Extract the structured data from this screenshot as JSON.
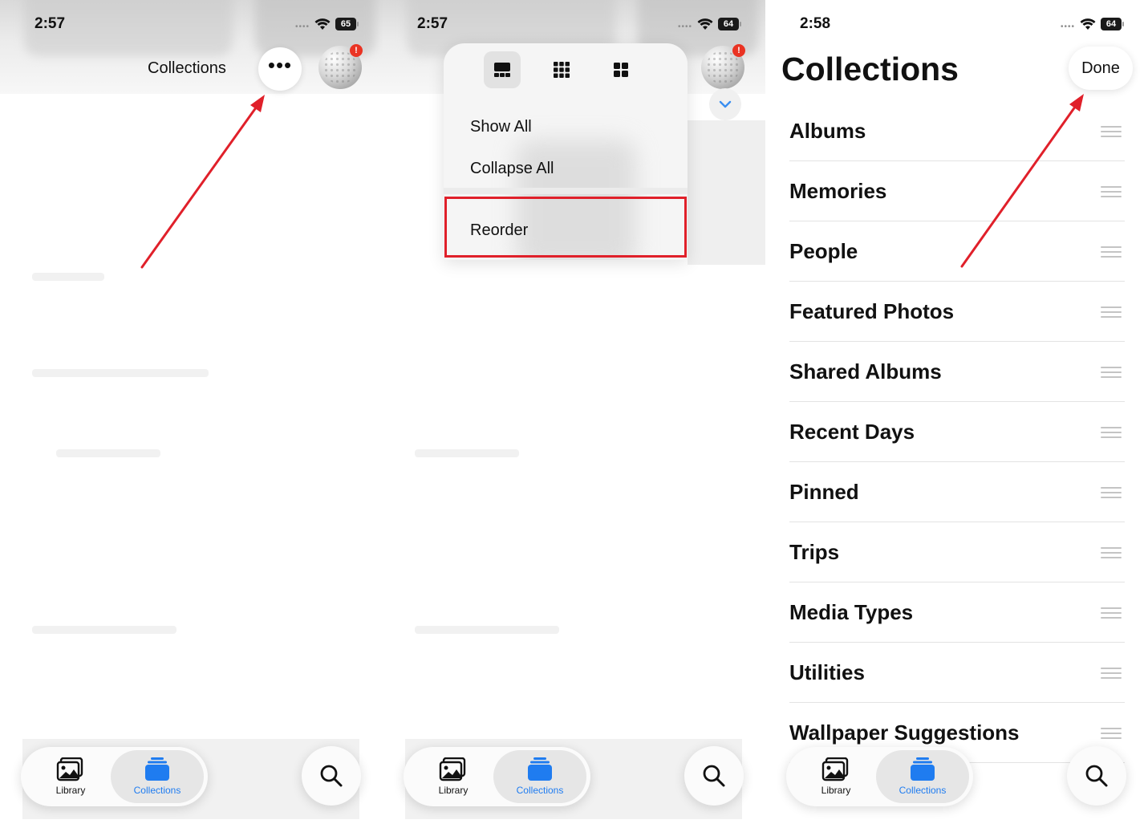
{
  "panel1": {
    "status": {
      "time": "2:57",
      "battery": "65"
    },
    "nav_title": "Collections",
    "more_button": "•••"
  },
  "panel2": {
    "status": {
      "time": "2:57",
      "battery": "64"
    },
    "menu": {
      "items": [
        "Show All",
        "Collapse All",
        "Reorder"
      ]
    }
  },
  "panel3": {
    "status": {
      "time": "2:58",
      "battery": "64"
    },
    "title": "Collections",
    "done_label": "Done",
    "rows": [
      "Albums",
      "Memories",
      "People",
      "Featured Photos",
      "Shared Albums",
      "Recent Days",
      "Pinned",
      "Trips",
      "Media Types",
      "Utilities",
      "Wallpaper Suggestions"
    ]
  },
  "tabbar": {
    "library_label": "Library",
    "collections_label": "Collections"
  },
  "colors": {
    "accent_blue": "#1f7cf0",
    "annotation_red": "#e0202a",
    "badge_red": "#ea3323"
  },
  "icons": [
    "wifi-icon",
    "battery-icon",
    "more-icon",
    "avatar-golfball",
    "layout-single-icon",
    "layout-grid-small-icon",
    "layout-grid-large-icon",
    "chevron-down-icon",
    "drag-handle-icon",
    "library-icon",
    "collections-icon",
    "search-icon"
  ]
}
